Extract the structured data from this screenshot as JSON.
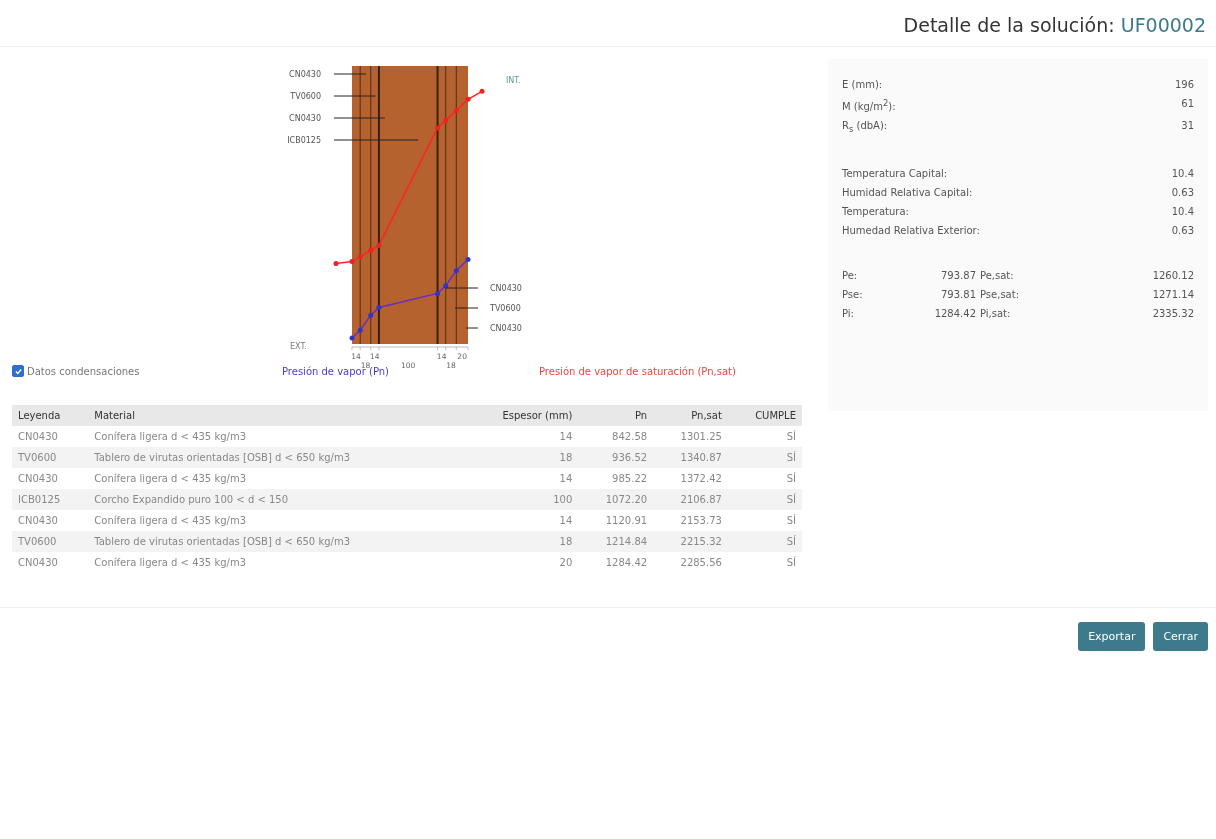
{
  "header": {
    "title": "Detalle de la solución:",
    "code": "UF00002"
  },
  "diagram": {
    "interior_label": "INT.",
    "exterior_label": "EXT.",
    "left_labels": [
      "CN0430",
      "TV0600",
      "CN0430",
      "ICB0125"
    ],
    "right_labels": [
      "CN0430",
      "TV0600",
      "CN0430"
    ],
    "ticks": [
      "14",
      "18",
      "14",
      "100",
      "14",
      "18",
      "20"
    ]
  },
  "legend": {
    "checkbox": {
      "label": "Datos condensaciones",
      "checked": true
    },
    "vapor": "Presión de vapor (Pn)",
    "saturation": "Presión de vapor de saturación (Pn,sat)"
  },
  "table": {
    "columns": [
      "Leyenda",
      "Material",
      "Espesor (mm)",
      "Pn",
      "Pn,sat",
      "CUMPLE"
    ],
    "rows": [
      [
        "CN0430",
        "Conífera ligera d < 435 kg/m3",
        "14",
        "842.58",
        "1301.25",
        "SÍ"
      ],
      [
        "TV0600",
        "Tablero de virutas orientadas [OSB] d < 650 kg/m3",
        "18",
        "936.52",
        "1340.87",
        "SÍ"
      ],
      [
        "CN0430",
        "Conífera ligera d < 435 kg/m3",
        "14",
        "985.22",
        "1372.42",
        "SÍ"
      ],
      [
        "ICB0125",
        "Corcho Expandido puro 100 < d < 150",
        "100",
        "1072.20",
        "2106.87",
        "SÍ"
      ],
      [
        "CN0430",
        "Conífera ligera d < 435 kg/m3",
        "14",
        "1120.91",
        "2153.73",
        "SÍ"
      ],
      [
        "TV0600",
        "Tablero de virutas orientadas [OSB] d < 650 kg/m3",
        "18",
        "1214.84",
        "2215.32",
        "SÍ"
      ],
      [
        "CN0430",
        "Conífera ligera d < 435 kg/m3",
        "20",
        "1284.42",
        "2285.56",
        "SÍ"
      ]
    ]
  },
  "summary": {
    "properties": [
      {
        "label": "E (mm):",
        "value": "196"
      },
      {
        "label": "M (kg/m$^{2}$):",
        "value": "61"
      },
      {
        "label": "R$_{s}$ (dbA):",
        "value": "31"
      }
    ],
    "conditions": [
      {
        "label": "Temperatura Capital:",
        "value": "10.4"
      },
      {
        "label": "Humidad Relativa Capital:",
        "value": "0.63"
      },
      {
        "label": "Temperatura:",
        "value": "10.4"
      },
      {
        "label": "Humedad Relativa Exterior:",
        "value": "0.63"
      }
    ],
    "pressures": [
      {
        "label": "Pe:",
        "value": "793.87",
        "sat_label": "Pe,sat:",
        "sat_value": "1260.12"
      },
      {
        "label": "Pse:",
        "value": "793.81",
        "sat_label": "Pse,sat:",
        "sat_value": "1271.14"
      },
      {
        "label": "Pi:",
        "value": "1284.42",
        "sat_label": "Pi,sat:",
        "sat_value": "2335.32"
      }
    ]
  },
  "buttons": [
    "Exportar",
    "Cerrar"
  ]
}
